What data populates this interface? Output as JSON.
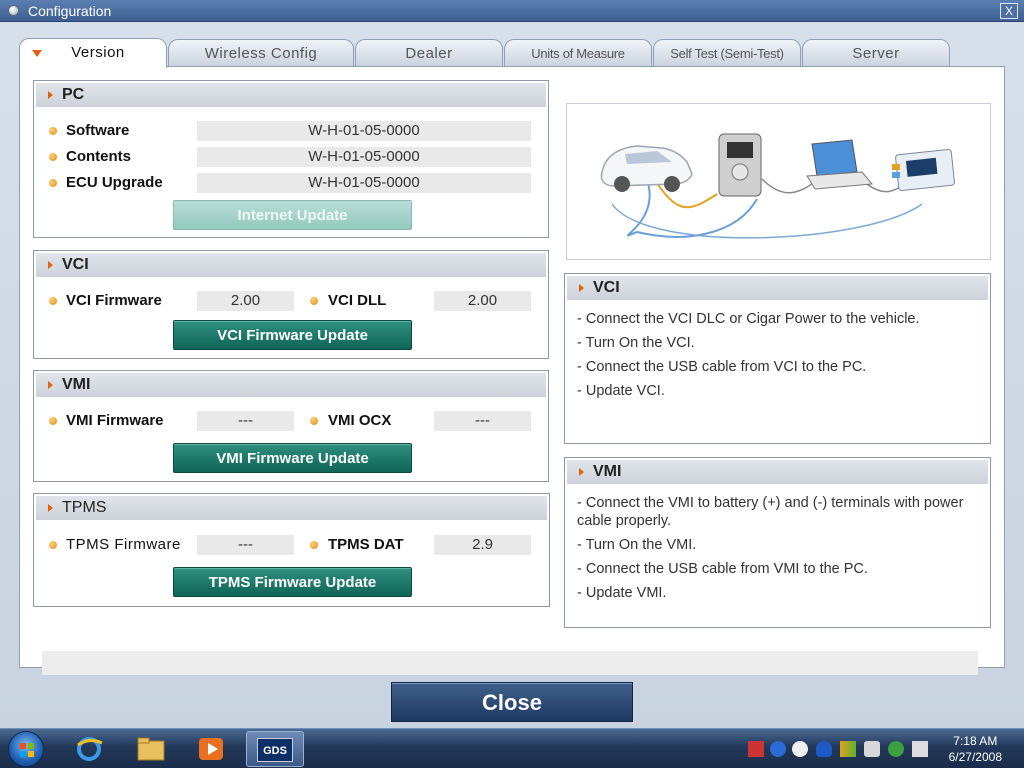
{
  "window": {
    "title": "Configuration",
    "close_glyph": "X"
  },
  "tabs": [
    {
      "label": "Version",
      "active": true
    },
    {
      "label": "Wireless Config"
    },
    {
      "label": "Dealer"
    },
    {
      "label": "Units of Measure"
    },
    {
      "label": "Self Test (Semi-Test)"
    },
    {
      "label": "Server"
    }
  ],
  "pc": {
    "heading": "PC",
    "rows": [
      {
        "label": "Software",
        "value": "W-H-01-05-0000"
      },
      {
        "label": "Contents",
        "value": "W-H-01-05-0000"
      },
      {
        "label": "ECU Upgrade",
        "value": "W-H-01-05-0000"
      }
    ],
    "button": "Internet Update"
  },
  "vci": {
    "heading": "VCI",
    "firmware_label": "VCI Firmware",
    "firmware_value": "2.00",
    "dll_label": "VCI DLL",
    "dll_value": "2.00",
    "button": "VCI Firmware Update"
  },
  "vmi": {
    "heading": "VMI",
    "firmware_label": "VMI Firmware",
    "firmware_value": "---",
    "ocx_label": "VMI OCX",
    "ocx_value": "---",
    "button": "VMI Firmware Update"
  },
  "tpms": {
    "heading": "TPMS",
    "firmware_label": "TPMS Firmware",
    "firmware_value": "---",
    "dat_label": "TPMS DAT",
    "dat_value": "2.9",
    "button": "TPMS Firmware Update"
  },
  "vci_info": {
    "heading": "VCI",
    "lines": [
      "- Connect the VCI DLC or Cigar Power to the vehicle.",
      "- Turn On the VCI.",
      "- Connect the USB cable from VCI to the PC.",
      "- Update VCI."
    ]
  },
  "vmi_info": {
    "heading": "VMI",
    "lines": [
      "- Connect the VMI to battery (+) and (-) terminals with power cable properly.",
      "- Turn On the VMI.",
      "- Connect the USB cable from VMI to the PC.",
      "- Update VMI."
    ]
  },
  "close_button": "Close",
  "taskbar": {
    "gds_label": "GDS",
    "clock_time": "7:18 AM",
    "clock_date": "6/27/2008"
  },
  "colors": {
    "accent_orange": "#e2630e",
    "button_teal": "#0f6557",
    "close_navy": "#1e3a63"
  }
}
